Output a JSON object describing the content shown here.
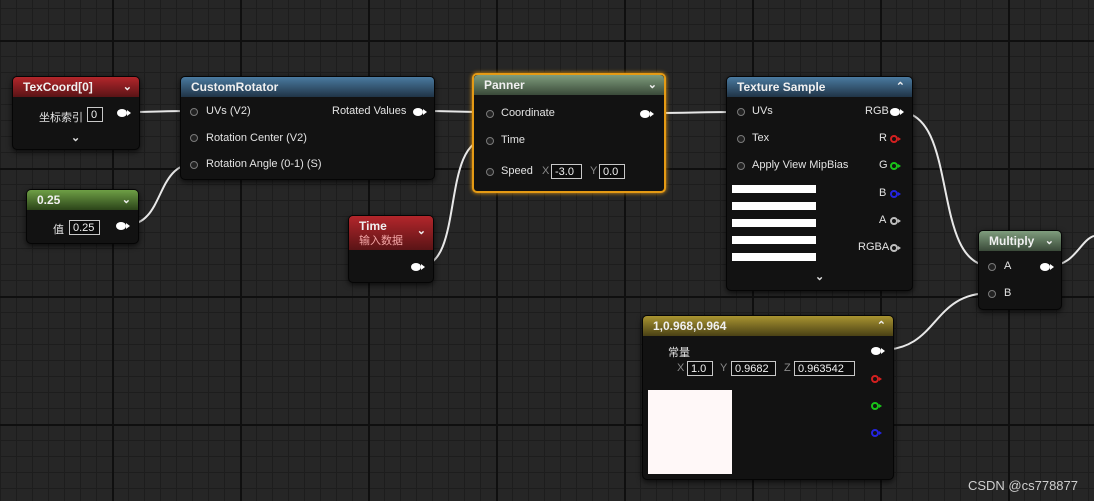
{
  "colors": {
    "selection_outline": "#e59a14",
    "grid_background": "#262626",
    "constant_swatch": "#fff8f8",
    "pin_red": "#d42020",
    "pin_green": "#19c419",
    "pin_blue": "#2424e0",
    "pin_alpha": "#bdbdbd"
  },
  "nodes": {
    "texcoord": {
      "title": "TexCoord[0]",
      "param_label": "坐标索引",
      "param_value": "0",
      "icon": "chevron-down-icon"
    },
    "custom_rotator": {
      "title": "CustomRotator",
      "inputs": [
        "UVs (V2)",
        "Rotation Center (V2)",
        "Rotation Angle (0-1) (S)"
      ],
      "output": "Rotated Values"
    },
    "scalar": {
      "title": "0.25",
      "param_label": "值",
      "param_value": "0.25"
    },
    "time": {
      "title": "Time",
      "subtitle": "输入数据"
    },
    "panner": {
      "title": "Panner",
      "inputs": [
        "Coordinate",
        "Time",
        "Speed"
      ],
      "speed_x_label": "X",
      "speed_x": "-3.0",
      "speed_y_label": "Y",
      "speed_y": "0.0"
    },
    "texture_sample": {
      "title": "Texture Sample",
      "inputs": [
        "UVs",
        "Tex",
        "Apply View MipBias"
      ],
      "outputs": [
        "RGB",
        "R",
        "G",
        "B",
        "A",
        "RGBA"
      ],
      "preview_icon": "texture-stripes-preview"
    },
    "constant3": {
      "title": "1,0.968,0.964",
      "param_label": "常量",
      "x_label": "X",
      "x": "1.0",
      "y_label": "Y",
      "y": "0.9682",
      "z_label": "Z",
      "z": "0.963542"
    },
    "multiply": {
      "title": "Multiply",
      "inputs": [
        "A",
        "B"
      ]
    }
  },
  "watermark": "CSDN @cs778877"
}
